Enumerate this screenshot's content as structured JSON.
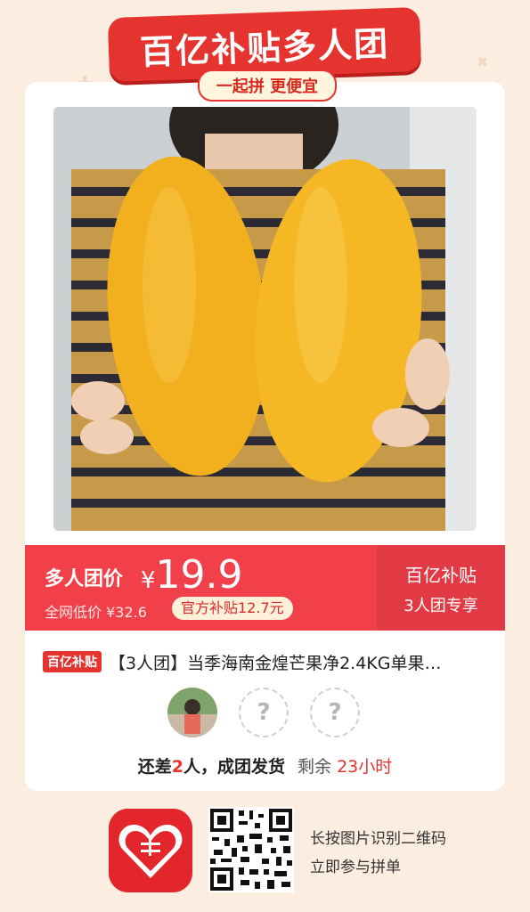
{
  "header": {
    "title": "百亿补贴多人团",
    "subtitle": "一起拼 更便宜"
  },
  "price": {
    "label": "多人团价",
    "currency": "¥",
    "value": "19.9",
    "low_price_label": "全网低价 ¥32.6",
    "subsidy_label": "官方补贴12.7元",
    "badge_line1": "百亿补贴",
    "badge_line2": "3人团专享"
  },
  "product": {
    "brand_tag": "百亿补贴",
    "title": "【3人团】当季海南金煌芒果净2.4KG单果…"
  },
  "group": {
    "members": [
      {
        "type": "avatar"
      },
      {
        "type": "empty",
        "symbol": "?"
      },
      {
        "type": "empty",
        "symbol": "?"
      }
    ],
    "status_prefix": "还差",
    "status_count": "2",
    "status_suffix": "人，成团发货",
    "remaining_label": "剩余",
    "remaining_time": "23小时"
  },
  "footer": {
    "line1": "长按图片识别二维码",
    "line2": "立即参与拼单"
  },
  "colors": {
    "accent": "#e5342f",
    "price_bar": "#f2404b",
    "background": "#fbeee0"
  }
}
